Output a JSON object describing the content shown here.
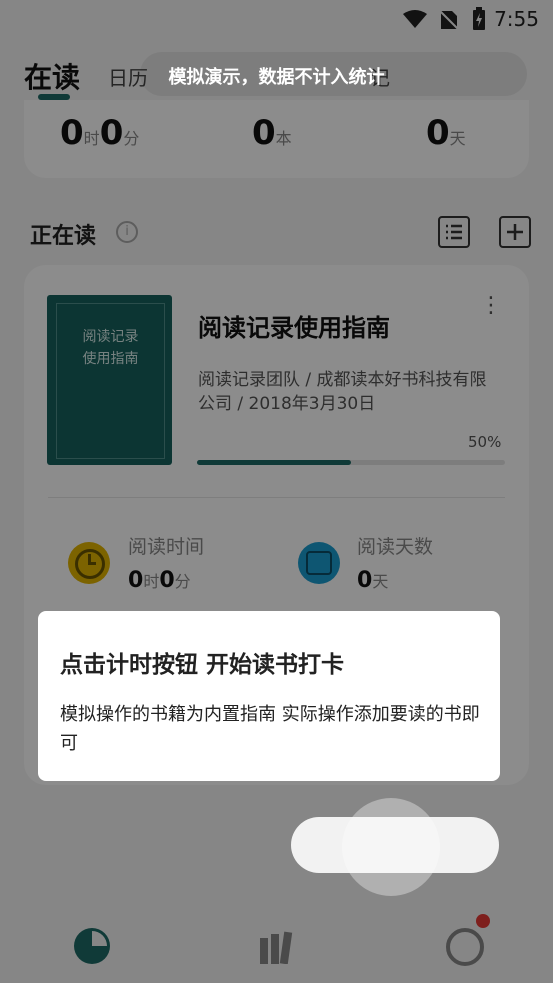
{
  "status_bar": {
    "time": "7:55"
  },
  "tabs": {
    "reading": "在读",
    "calendar": "日历",
    "more": "记"
  },
  "banner": {
    "text": "模拟演示，数据不计入统计"
  },
  "stats": {
    "hours": "0",
    "hours_unit": "时",
    "minutes": "0",
    "minutes_unit": "分",
    "books": "0",
    "books_unit": "本",
    "days": "0",
    "days_unit": "天"
  },
  "section": {
    "title": "正在读",
    "info_glyph": "i"
  },
  "book": {
    "cover_title_line1": "阅读记录",
    "cover_title_line2": "使用指南",
    "title": "阅读记录使用指南",
    "meta": "阅读记录团队 / 成都读本好书科技有限公司 / 2018年3月30日",
    "progress_label": "50%",
    "progress": 0.5,
    "menu_glyph": "⋮"
  },
  "book_stats": {
    "time_label": "阅读时间",
    "time_hours": "0",
    "time_hours_unit": "时",
    "time_minutes": "0",
    "time_minutes_unit": "分",
    "days_label": "阅读天数",
    "days_value": "0",
    "days_unit": "天"
  },
  "tip": {
    "title": "点击计时按钮 开始读书打卡",
    "body": "模拟操作的书籍为内置指南 实际操作添加要读的书即可"
  },
  "colors": {
    "accent": "#1e6b66",
    "badge": "#e53935",
    "clock": "#e2b400",
    "calendar": "#1b9dd0"
  }
}
